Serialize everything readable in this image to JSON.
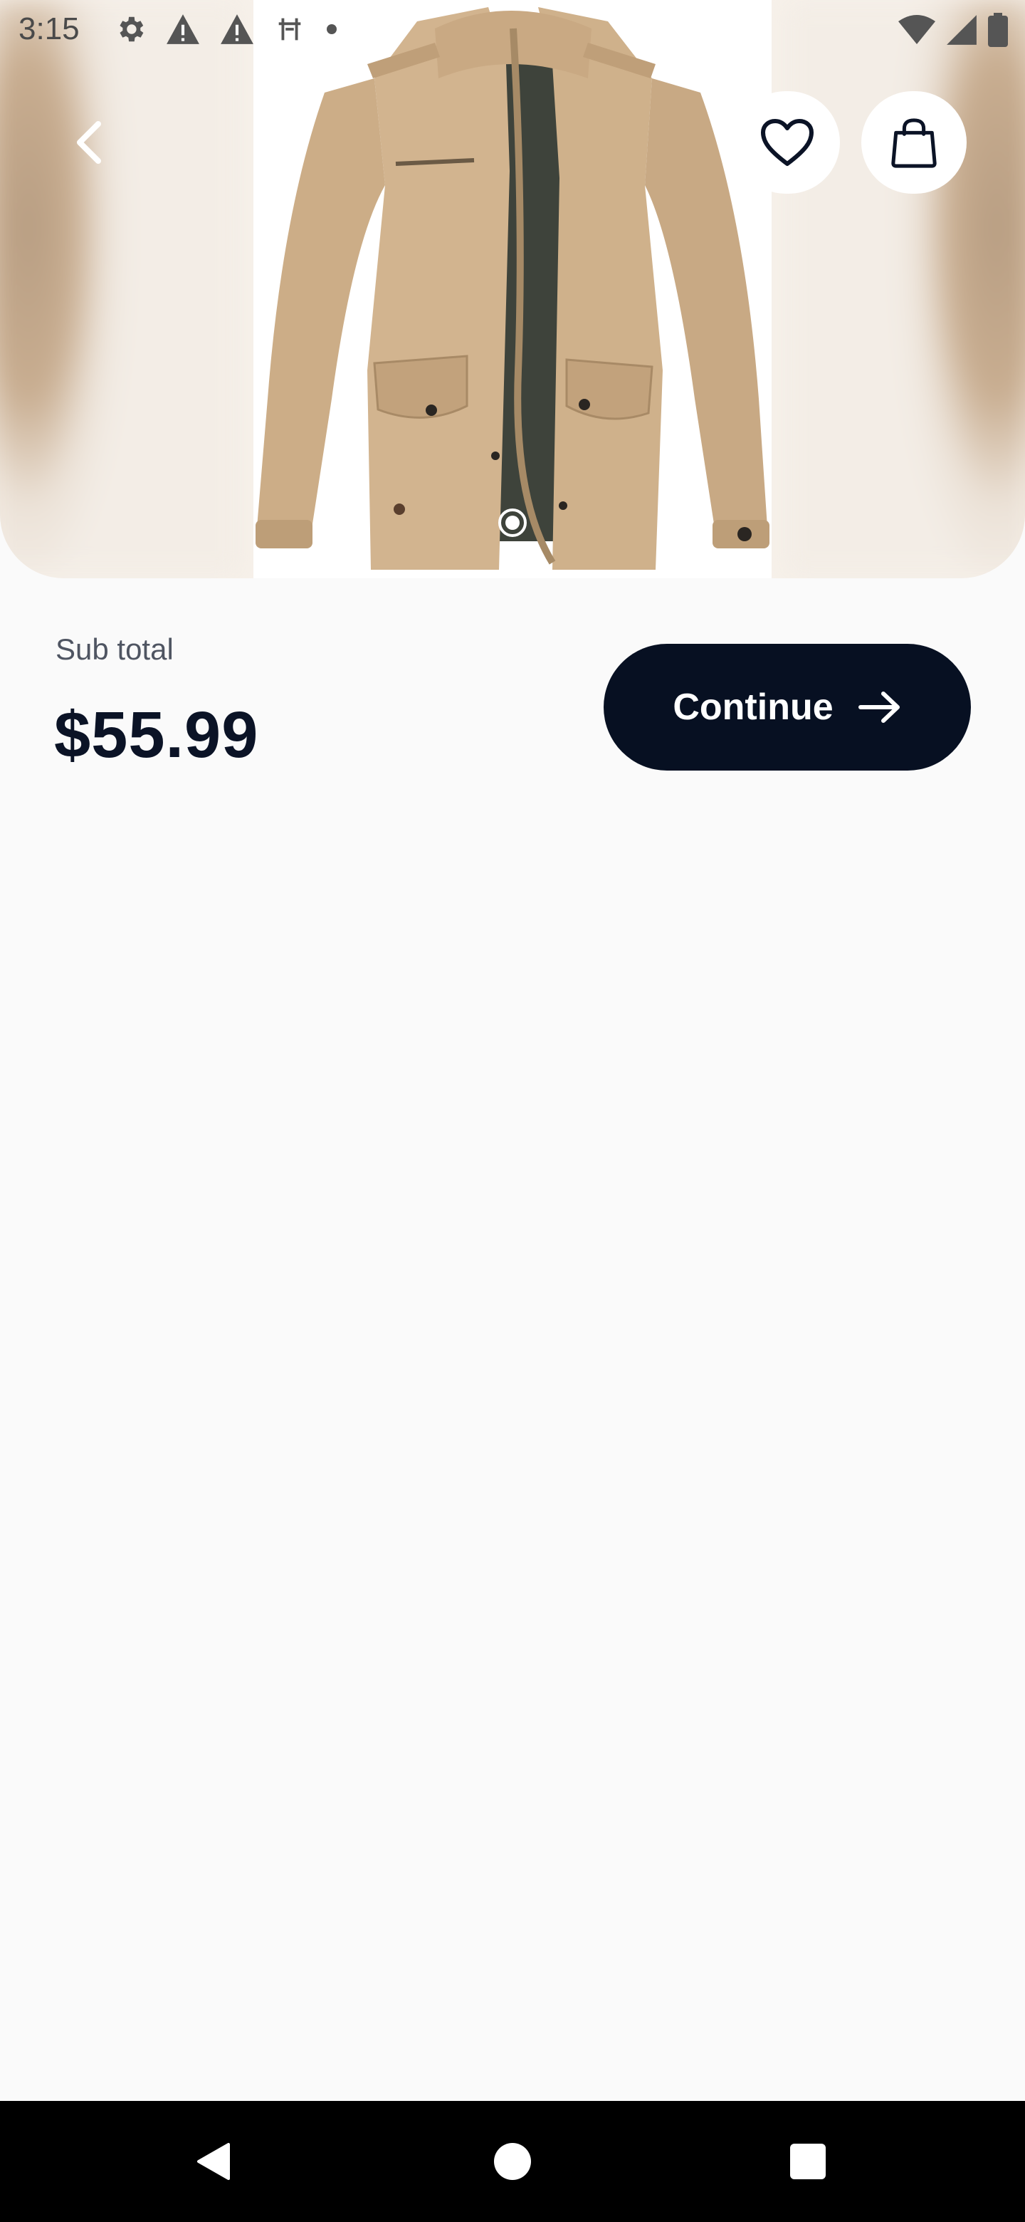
{
  "status_bar": {
    "time": "3:15",
    "left_icons": [
      "settings-gear-icon",
      "alert-triangle-icon",
      "alert-triangle-icon",
      "antenna-icon",
      "dot-icon"
    ],
    "right_icons": [
      "wifi-icon",
      "cell-signal-icon",
      "battery-icon"
    ]
  },
  "product": {
    "image_description_icon": "khaki-jacket-image",
    "carousel_active_index": 1,
    "carousel_total": 1
  },
  "header": {
    "back_icon": "chevron-left-icon",
    "favorite_icon": "heart-icon",
    "cart_icon": "shopping-bag-icon"
  },
  "checkout": {
    "subtotal_label": "Sub total",
    "subtotal_value": "$55.99",
    "continue_label": "Continue",
    "continue_icon": "arrow-right-icon"
  },
  "colors": {
    "primary_dark": "#071022",
    "text_muted": "#4f5562",
    "background": "#fafafa",
    "jacket_khaki": "#d2b48f"
  },
  "nav_bar": {
    "back_icon": "nav-back-triangle-icon",
    "home_icon": "nav-home-circle-icon",
    "recents_icon": "nav-recents-square-icon"
  }
}
